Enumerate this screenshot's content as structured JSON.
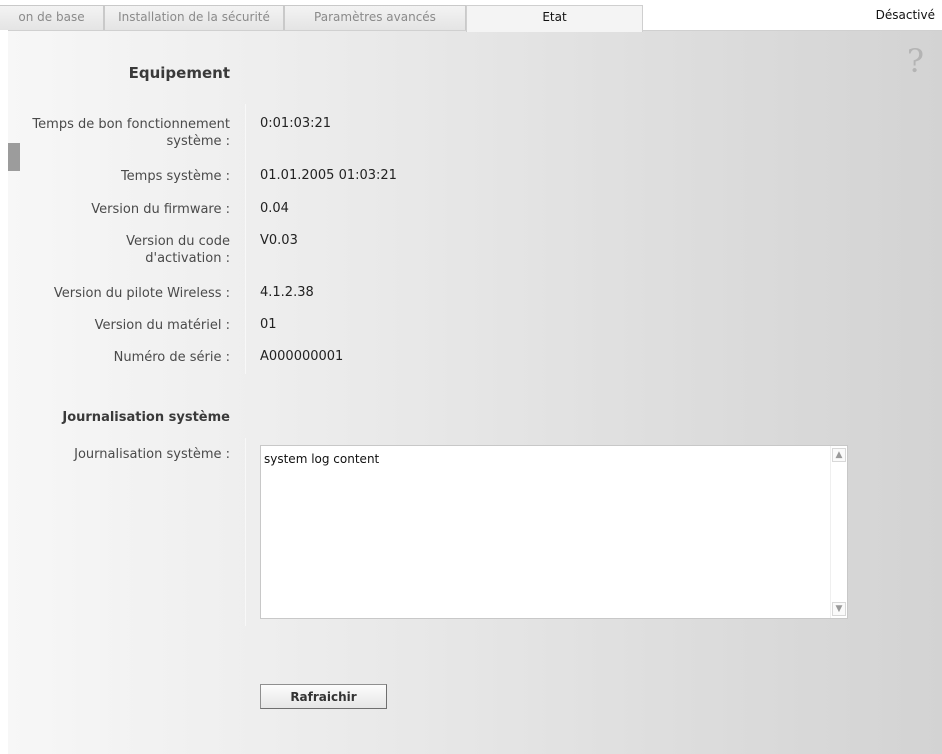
{
  "tabs": [
    {
      "label": "on de base",
      "active": false
    },
    {
      "label": "Installation de la sécurité",
      "active": false
    },
    {
      "label": "Paramètres avancés",
      "active": false
    },
    {
      "label": "Etat",
      "active": true
    }
  ],
  "header": {
    "status": "Désactivé"
  },
  "help": {
    "icon": "help-icon",
    "glyph": "?"
  },
  "equipment": {
    "title": "Equipement",
    "rows": [
      {
        "label": "Temps de bon fonctionnement système :",
        "value": "0:01:03:21"
      },
      {
        "label": "Temps système :",
        "value": "01.01.2005 01:03:21"
      },
      {
        "label": "Version du firmware :",
        "value": "0.04"
      },
      {
        "label": "Version du code d'activation :",
        "value": "V0.03"
      },
      {
        "label": "Version du pilote Wireless :",
        "value": "4.1.2.38"
      },
      {
        "label": "Version du matériel :",
        "value": "01"
      },
      {
        "label": "Numéro de série :",
        "value": "A000000001"
      }
    ]
  },
  "syslog": {
    "title": "Journalisation système",
    "label": "Journalisation système :",
    "content": "system log content",
    "refresh_label": "Rafraichir"
  },
  "colors": {
    "panel": "#e4e4e4",
    "active_tab": "#f4f4f4",
    "text": "#222222"
  }
}
